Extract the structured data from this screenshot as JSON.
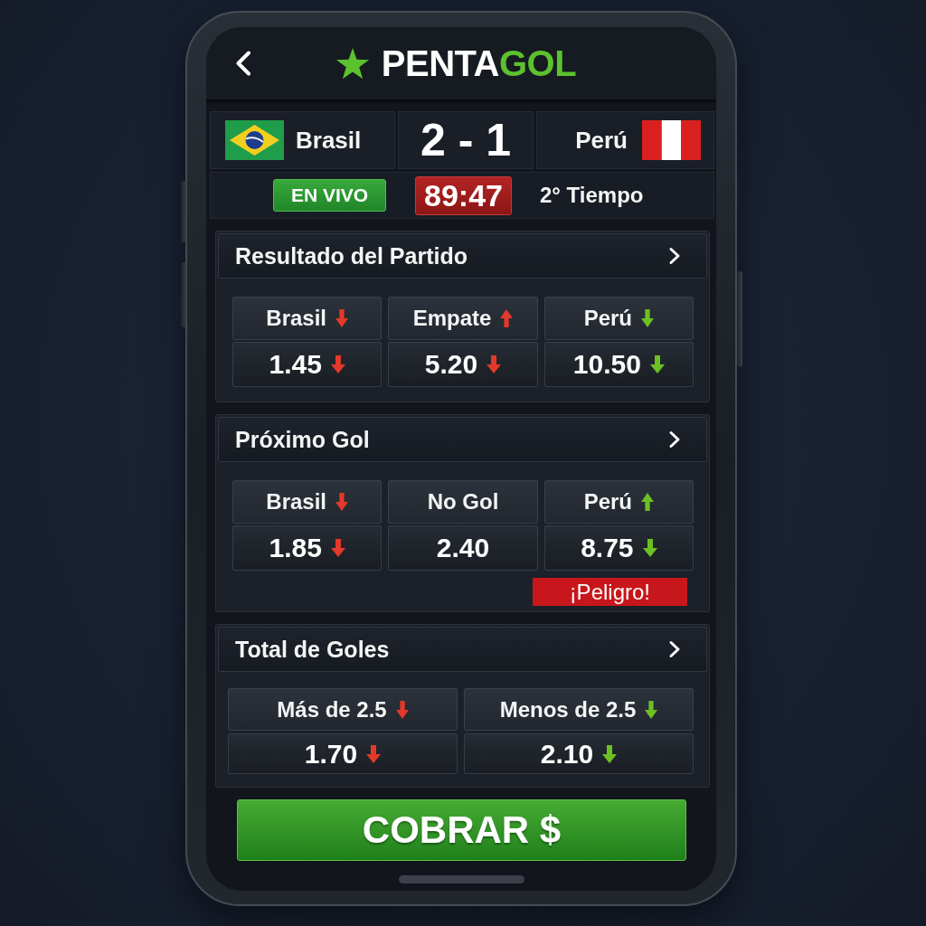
{
  "header": {
    "logo": {
      "main": "PENTA",
      "accent": "GOL"
    }
  },
  "match": {
    "home": {
      "name": "Brasil",
      "flag": {
        "kind": "brazil"
      }
    },
    "score": "2 - 1",
    "away": {
      "name": "Perú",
      "flag": {
        "kind": "peru"
      }
    },
    "live_badge": "EN VIVO",
    "clock": "89:47",
    "period": "2° Tiempo"
  },
  "markets": [
    {
      "title": "Resultado del Partido",
      "selections": [
        {
          "label": "Brasil",
          "label_arrow": {
            "up": false,
            "color": "#e2392a"
          },
          "odds": "1.45",
          "odds_arrow": {
            "up": false,
            "color": "#e2392a"
          }
        },
        {
          "label": "Empate",
          "label_arrow": {
            "up": true,
            "color": "#e2392a"
          },
          "odds": "5.20",
          "odds_arrow": {
            "up": false,
            "color": "#e2392a"
          }
        },
        {
          "label": "Perú",
          "label_arrow": {
            "up": false,
            "color": "#6cc024"
          },
          "odds": "10.50",
          "odds_arrow": {
            "up": false,
            "color": "#6cc024"
          }
        }
      ]
    },
    {
      "title": "Próximo Gol",
      "selections": [
        {
          "label": "Brasil",
          "label_arrow": {
            "up": false,
            "color": "#e2392a"
          },
          "odds": "1.85",
          "odds_arrow": {
            "up": false,
            "color": "#e2392a"
          }
        },
        {
          "label": "No Gol",
          "odds": "2.40"
        },
        {
          "label": "Perú",
          "label_arrow": {
            "up": true,
            "color": "#6cc024"
          },
          "odds": "8.75",
          "odds_arrow": {
            "up": false,
            "color": "#6cc024"
          },
          "alert": "¡Peligro!"
        }
      ]
    },
    {
      "title": "Total de Goles",
      "selections": [
        {
          "label": "Más de 2.5",
          "label_arrow": {
            "up": false,
            "color": "#e2392a"
          },
          "odds": "1.70",
          "odds_arrow": {
            "up": false,
            "color": "#e2392a"
          }
        },
        {
          "label": "Menos de 2.5",
          "label_arrow": {
            "up": false,
            "color": "#6cc024"
          },
          "odds": "2.10",
          "odds_arrow": {
            "up": false,
            "color": "#6cc024"
          }
        }
      ]
    }
  ],
  "cashout_button": "COBRAR $"
}
